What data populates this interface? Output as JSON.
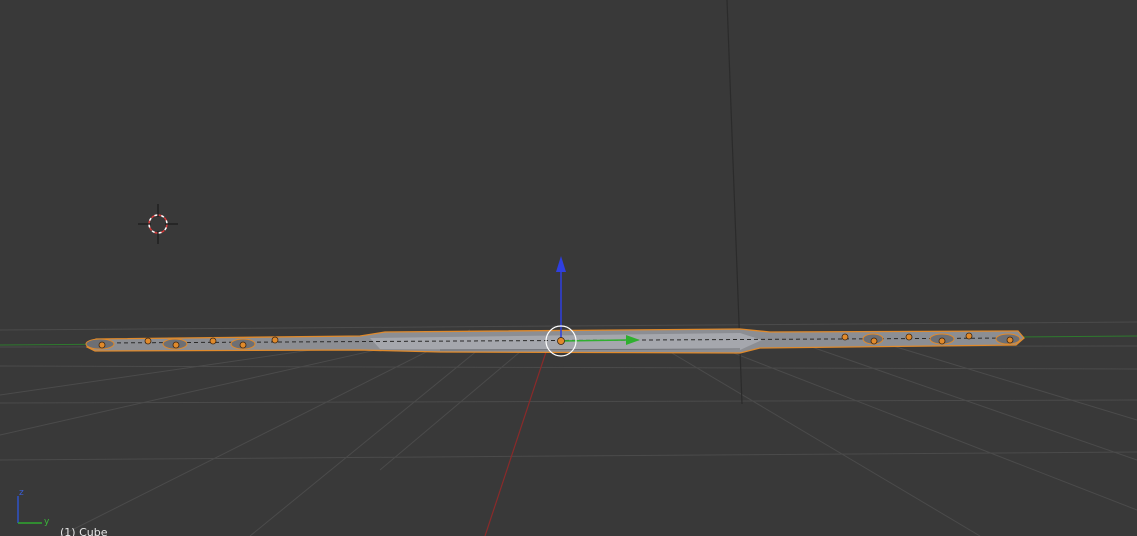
{
  "viewport": {
    "object_info": "(1) Cube",
    "background_color": "#393939",
    "grid_color": "#4a4a4a"
  },
  "axes": {
    "x_color": "#a83232",
    "y_color": "#2fa82f",
    "z_color": "#2f52c8",
    "x_label": "",
    "y_label": "y",
    "z_label": "z"
  },
  "selection": {
    "outline_color": "#e08a2b",
    "vertex_color": "#e08a2b",
    "mesh_color": "#9a9ca2"
  },
  "icons": {
    "cursor": "3d-cursor-icon",
    "transform_gizmo": "translate-gizmo-icon",
    "orientation": "axis-orientation-icon"
  }
}
